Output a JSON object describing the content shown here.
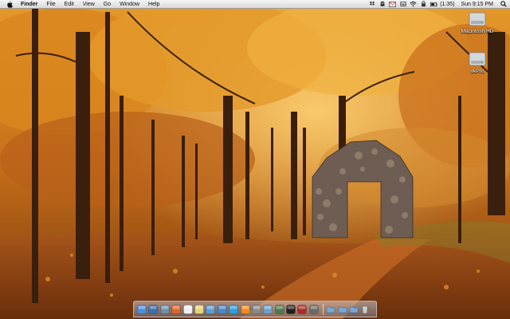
{
  "menubar": {
    "app_name": "Finder",
    "menus": [
      "File",
      "Edit",
      "View",
      "Go",
      "Window",
      "Help"
    ],
    "battery": "(1:35)",
    "clock": "Sun 9:15 PM",
    "status_icons": [
      "dropbox-icon",
      "ghost-icon",
      "gmail-icon",
      "tray-icon",
      "wifi-icon",
      "lock-icon",
      "battery-icon",
      "search-icon"
    ]
  },
  "desktop": {
    "icons": [
      {
        "label": "Macintosh HD",
        "icon": "hard-drive-icon"
      },
      {
        "label": "okPro",
        "icon": "hard-drive-icon"
      }
    ]
  },
  "dock": {
    "apps": [
      {
        "name": "finder-dock-icon",
        "color": "#4a8fe0"
      },
      {
        "name": "dashboard-dock-icon",
        "color": "#3a6fb0"
      },
      {
        "name": "preview-dock-icon",
        "color": "#6f8fa8"
      },
      {
        "name": "firefox-dock-icon",
        "color": "#e0672a"
      },
      {
        "name": "calendar-dock-icon",
        "color": "#eeeeee"
      },
      {
        "name": "notes-dock-icon",
        "color": "#e6d27a"
      },
      {
        "name": "itunes-dock-icon",
        "color": "#5aa0d8"
      },
      {
        "name": "app-store-dock-icon",
        "color": "#4a86c8"
      },
      {
        "name": "skype-dock-icon",
        "color": "#2aa0e0"
      },
      {
        "name": "vlc-dock-icon",
        "color": "#f08a1c"
      },
      {
        "name": "system-prefs-dock-icon",
        "color": "#8a8a8a"
      },
      {
        "name": "mail-dock-icon",
        "color": "#6aa0d0"
      },
      {
        "name": "activity-monitor-dock-icon",
        "color": "#4d7a4d"
      },
      {
        "name": "terminal-dock-icon",
        "color": "#222222"
      },
      {
        "name": "photobooth-dock-icon",
        "color": "#b02828"
      },
      {
        "name": "utility-dock-icon",
        "color": "#6a6a6a"
      }
    ],
    "stacks": [
      {
        "name": "applications-folder-icon",
        "color": "#7aa8d6"
      },
      {
        "name": "documents-folder-icon",
        "color": "#7aa8d6"
      },
      {
        "name": "downloads-folder-icon",
        "color": "#7aa8d6"
      },
      {
        "name": "trash-icon",
        "color": "#c8ccd0"
      }
    ]
  },
  "colors": {
    "menubar_bg": "#e6e6e6",
    "foliage": "#d9861e",
    "foliage_light": "#f2b13a",
    "trunk": "#3a1f0c",
    "path": "#b8621e",
    "arch_stone": "#6e5d52"
  }
}
